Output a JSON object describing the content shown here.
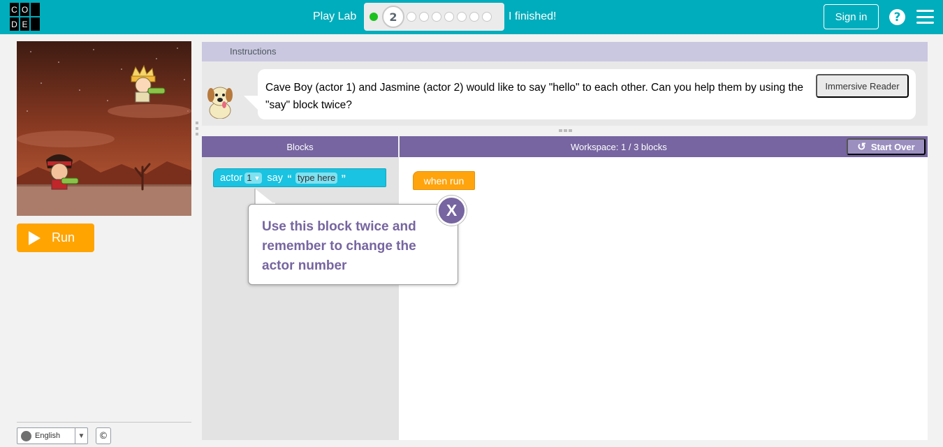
{
  "header": {
    "logo_letters": [
      "C",
      "O",
      "D",
      "E"
    ],
    "title": "Play Lab",
    "current_level": "2",
    "finished_label": "I finished!",
    "signin_label": "Sign in",
    "help_label": "?",
    "brand_color": "#00adbc"
  },
  "game": {
    "run_label": "Run",
    "run_color": "#ffa400"
  },
  "footer": {
    "language": "English",
    "copyright_symbol": "©"
  },
  "instructions": {
    "title": "Instructions",
    "text": "Cave Boy (actor 1) and Jasmine (actor 2) would like to say \"hello\" to each other. Can you help them by using the \"say\" block twice?",
    "immersive_reader_label": "Immersive Reader"
  },
  "blocks_panel": {
    "title": "Blocks",
    "say_block": {
      "actor_label": "actor",
      "actor_value": "1",
      "say_label": "say",
      "open_quote": "“",
      "placeholder": "type here",
      "close_quote": "”"
    }
  },
  "workspace": {
    "title": "Workspace: 1 / 3 blocks",
    "start_over_label": "Start Over",
    "when_run_label": "when run"
  },
  "tooltip": {
    "text": "Use this block twice and remember to change the actor number",
    "close_label": "X"
  },
  "colors": {
    "header_purple": "#7665a0",
    "block_cyan": "#19c3e1",
    "event_orange": "#ffa40c"
  }
}
